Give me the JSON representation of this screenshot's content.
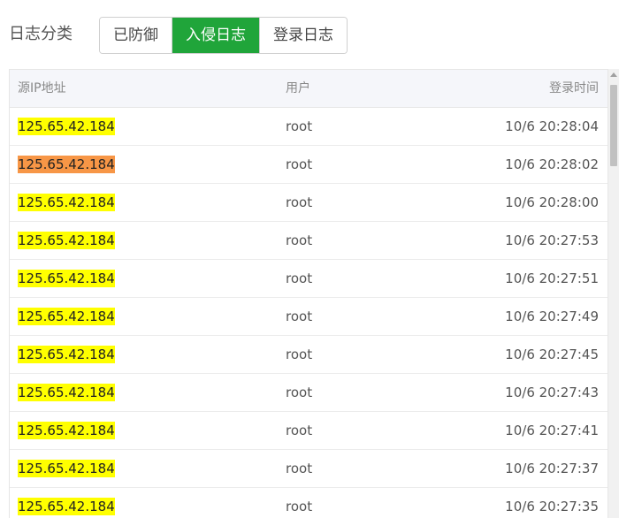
{
  "toolbar": {
    "label": "日志分类",
    "buttons": [
      {
        "label": "已防御",
        "active": false
      },
      {
        "label": "入侵日志",
        "active": true
      },
      {
        "label": "登录日志",
        "active": false
      }
    ]
  },
  "table": {
    "headers": {
      "ip": "源IP地址",
      "user": "用户",
      "time": "登录时间"
    },
    "rows": [
      {
        "ip": "125.65.42.184",
        "user": "root",
        "time": "10/6 20:28:04",
        "highlight": "yellow"
      },
      {
        "ip": "125.65.42.184",
        "user": "root",
        "time": "10/6 20:28:02",
        "highlight": "orange"
      },
      {
        "ip": "125.65.42.184",
        "user": "root",
        "time": "10/6 20:28:00",
        "highlight": "yellow"
      },
      {
        "ip": "125.65.42.184",
        "user": "root",
        "time": "10/6 20:27:53",
        "highlight": "yellow"
      },
      {
        "ip": "125.65.42.184",
        "user": "root",
        "time": "10/6 20:27:51",
        "highlight": "yellow"
      },
      {
        "ip": "125.65.42.184",
        "user": "root",
        "time": "10/6 20:27:49",
        "highlight": "yellow"
      },
      {
        "ip": "125.65.42.184",
        "user": "root",
        "time": "10/6 20:27:45",
        "highlight": "yellow"
      },
      {
        "ip": "125.65.42.184",
        "user": "root",
        "time": "10/6 20:27:43",
        "highlight": "yellow"
      },
      {
        "ip": "125.65.42.184",
        "user": "root",
        "time": "10/6 20:27:41",
        "highlight": "yellow"
      },
      {
        "ip": "125.65.42.184",
        "user": "root",
        "time": "10/6 20:27:37",
        "highlight": "yellow"
      },
      {
        "ip": "125.65.42.184",
        "user": "root",
        "time": "10/6 20:27:35",
        "highlight": "yellow"
      }
    ]
  },
  "colors": {
    "accent": "#20a53a",
    "highlight_yellow": "#ffff00",
    "highlight_orange": "#f79646"
  }
}
